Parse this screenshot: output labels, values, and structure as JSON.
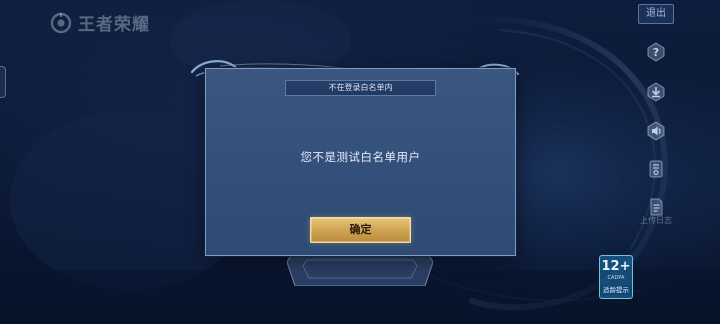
{
  "game": {
    "logo_text": "王者荣耀"
  },
  "toolbar": {
    "exit_label": "退出",
    "upload_log_label": "上传日志",
    "icons": [
      "help-icon",
      "download-icon",
      "speaker-icon",
      "repair-icon",
      "upload-log-icon"
    ]
  },
  "age_rating": {
    "number": "12+",
    "code": "CADPA",
    "tip": "适龄提示"
  },
  "dialog": {
    "title": "不在登录白名单内",
    "message": "您不是测试白名单用户",
    "confirm_label": "确定"
  },
  "colors": {
    "background": "#0d1d3f",
    "dialog_fill": "#34517b",
    "button_gold": "#cfa453",
    "frame_accent": "#8fb0d9"
  }
}
